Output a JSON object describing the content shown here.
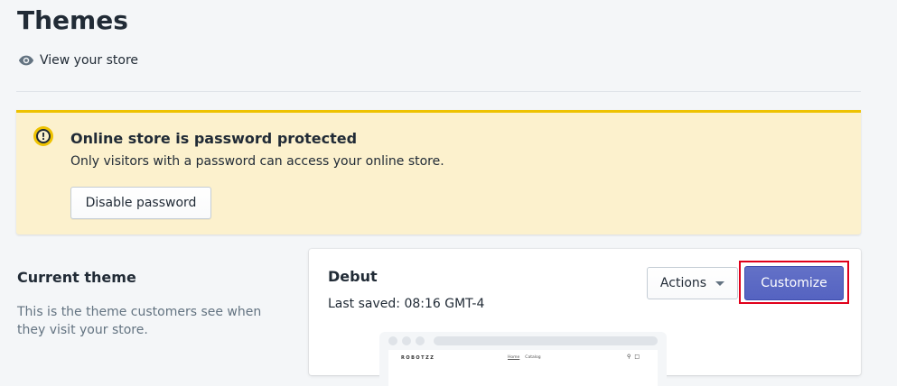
{
  "header": {
    "title": "Themes",
    "view_store_label": "View your store",
    "view_store_icon": "eye-icon"
  },
  "banner": {
    "icon": "warning-circle-icon",
    "title": "Online store is password protected",
    "text": "Only visitors with a password can access your online store.",
    "button_label": "Disable password",
    "colors": {
      "background": "#fcf1cd",
      "accent": "#eec200"
    }
  },
  "current_theme": {
    "section_title": "Current theme",
    "section_description": "This is the theme customers see when they visit your store.",
    "theme_name": "Debut",
    "last_saved": "Last saved: 08:16 GMT-4",
    "actions_label": "Actions",
    "customize_label": "Customize",
    "colors": {
      "primary": "#5c6ac4",
      "highlight": "#e0001b"
    },
    "preview": {
      "logo_text": "ROBOTZZ",
      "nav_items": [
        "Home",
        "Catalog"
      ],
      "icons": [
        "search-icon",
        "cart-icon"
      ]
    }
  }
}
